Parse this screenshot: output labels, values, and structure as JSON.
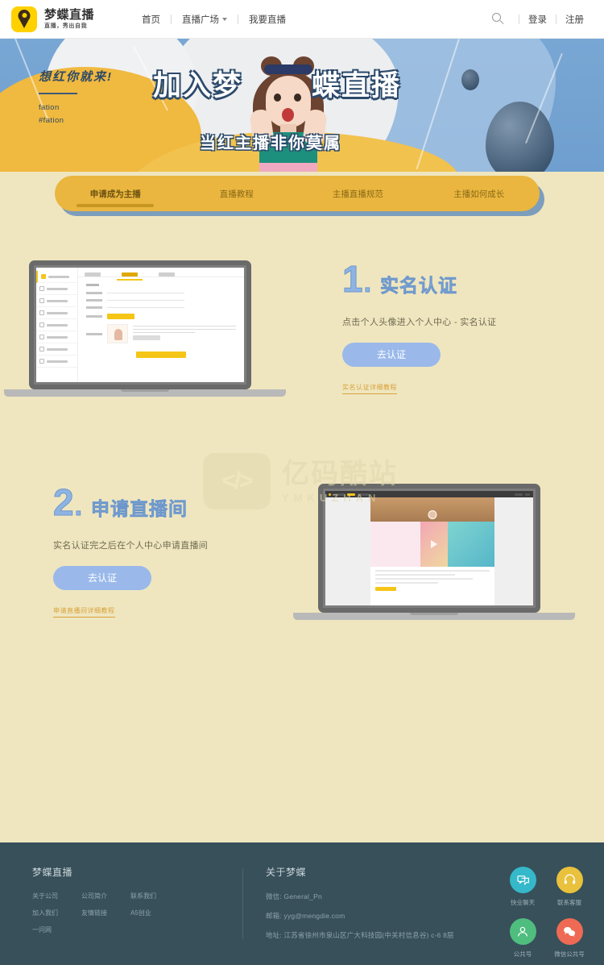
{
  "header": {
    "brand_name": "梦蝶直播",
    "brand_slogan": "直播，秀出自我",
    "logo_icon": "location-pin-icon",
    "nav": [
      {
        "label": "首页",
        "has_caret": false
      },
      {
        "label": "直播广场",
        "has_caret": true
      },
      {
        "label": "我要直播",
        "has_caret": false
      }
    ],
    "search_icon": "search-icon",
    "login_label": "登录",
    "register_label": "注册"
  },
  "banner": {
    "left_title": "想红你就来!",
    "left_sub_line1": "fation",
    "left_sub_line2": "#fation",
    "title_part1": "加入梦",
    "title_part2": "蝶直播",
    "subtitle": "当红主播非你莫属",
    "bg_color": "#79a7d4",
    "accent_yellow": "#f0b93f"
  },
  "tabs": {
    "active_index": 0,
    "items": [
      {
        "label": "申请成为主播"
      },
      {
        "label": "直播教程"
      },
      {
        "label": "主播直播规范"
      },
      {
        "label": "主播如何成长"
      }
    ]
  },
  "steps": [
    {
      "number": "1",
      "number_dot": ".",
      "title": "实名认证",
      "desc": "点击个人头像进入个人中心 - 实名认证",
      "button_label": "去认证",
      "link_label": "实名认证详细教程",
      "image_side": "left"
    },
    {
      "number": "2",
      "number_dot": ".",
      "title": "申请直播间",
      "desc": "实名认证完之后在个人中心申请直播间",
      "button_label": "去认证",
      "link_label": "申请直播间详细教程",
      "image_side": "right"
    }
  ],
  "watermark": {
    "icon": "code-brackets-icon",
    "icon_glyph": "</>",
    "cn": "亿码酷站",
    "en": "YMKUZHAN"
  },
  "footer": {
    "brand_title": "梦蝶直播",
    "links": [
      {
        "label": "关于公司"
      },
      {
        "label": "公司简介"
      },
      {
        "label": "联系我们"
      },
      {
        "label": "加入我们"
      },
      {
        "label": "友情链接"
      },
      {
        "label": "A5创业"
      },
      {
        "label": "一问网"
      }
    ],
    "about_title": "关于梦蝶",
    "about_lines": [
      "微信: General_Pn",
      "邮箱: yyg@mengdie.com",
      "地址: 江苏省徐州市泉山区广大科技园(中关村信息谷) c-6 8层"
    ],
    "social": [
      {
        "label": "快业聊天",
        "icon": "chat-bubble-icon",
        "color": "#35b8c9"
      },
      {
        "label": "联系客服",
        "icon": "headset-support-icon",
        "color": "#e9c13c"
      },
      {
        "label": "公共号",
        "icon": "user-person-icon",
        "color": "#4fbd7e"
      },
      {
        "label": "微信公共号",
        "icon": "wechat-icon",
        "color": "#ef6a54"
      }
    ]
  }
}
